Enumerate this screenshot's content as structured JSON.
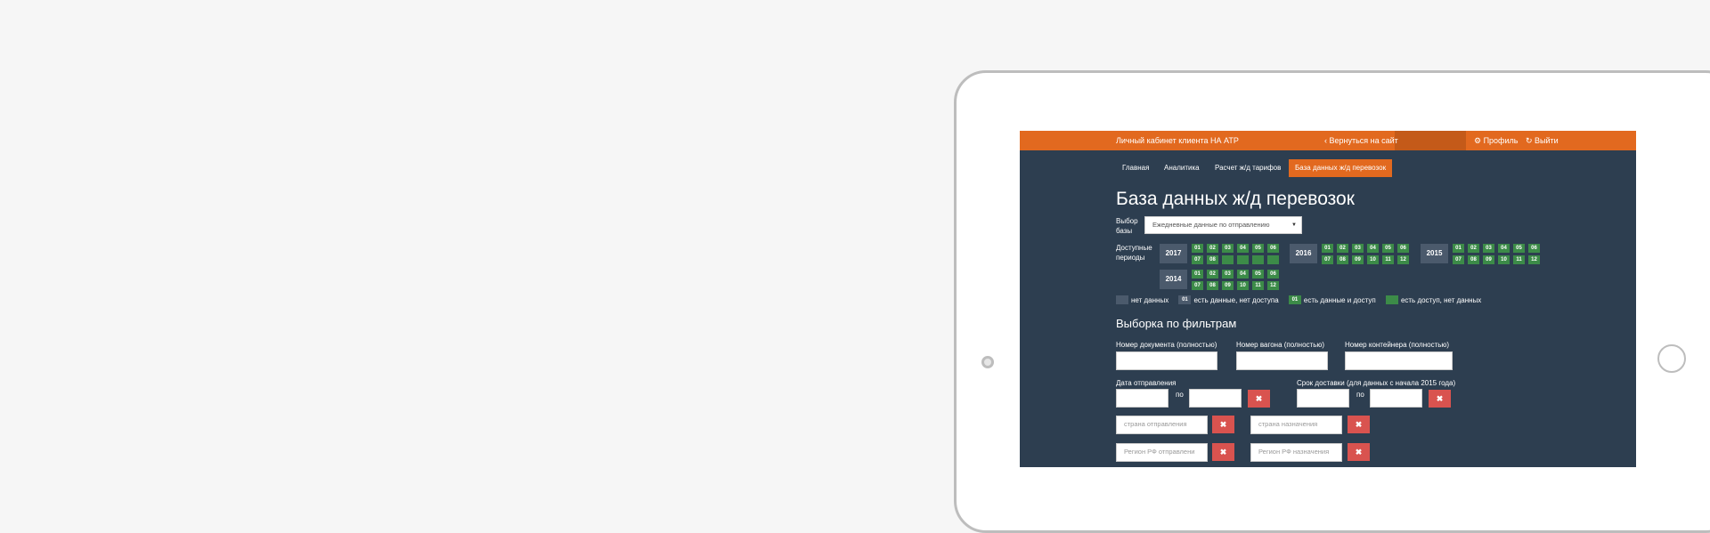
{
  "header": {
    "title": "Личный кабинет клиента НА АТР",
    "back_label": "Вернуться на сайт",
    "profile_label": "Профиль",
    "logout_label": "Выйти"
  },
  "tabs": [
    {
      "label": "Главная"
    },
    {
      "label": "Аналитика"
    },
    {
      "label": "Расчет ж/д тарифов"
    },
    {
      "label": "База данных ж/д перевозок",
      "active": true
    }
  ],
  "page_title": "База данных ж/д перевозок",
  "base_select": {
    "label": "Выбор базы",
    "value": "Ежедневные данные по отправлению"
  },
  "periods": {
    "label": "Доступные периоды",
    "years": [
      {
        "year": "2017",
        "months": [
          "01",
          "02",
          "03",
          "04",
          "05",
          "06",
          "07",
          "08",
          "",
          "",
          "",
          ""
        ]
      },
      {
        "year": "2016",
        "months": [
          "01",
          "02",
          "03",
          "04",
          "05",
          "06",
          "07",
          "08",
          "09",
          "10",
          "11",
          "12"
        ]
      },
      {
        "year": "2015",
        "months": [
          "01",
          "02",
          "03",
          "04",
          "05",
          "06",
          "07",
          "08",
          "09",
          "10",
          "11",
          "12"
        ]
      },
      {
        "year": "2014",
        "months": [
          "01",
          "02",
          "03",
          "04",
          "05",
          "06",
          "07",
          "08",
          "09",
          "10",
          "11",
          "12"
        ]
      }
    ]
  },
  "legend": [
    {
      "swatch": "",
      "color": "#4b5a6c",
      "text": "нет данных"
    },
    {
      "swatch": "01",
      "color": "#4b5a6c",
      "text": "есть данные, нет доступа"
    },
    {
      "swatch": "01",
      "color": "#3c8b48",
      "text": "есть данные и доступ"
    },
    {
      "swatch": "",
      "color": "#3c8b48",
      "text": "есть доступ, нет данных"
    }
  ],
  "filters": {
    "title": "Выборка по фильтрам",
    "doc_label": "Номер документа (полностью)",
    "wagon_label": "Номер вагона (полностью)",
    "container_label": "Номер контейнера (полностью)",
    "date_label": "Дата отправления",
    "delivery_label": "Срок доставки (для данных с начала 2015 года)",
    "to_label": "по",
    "country_from_placeholder": "страна отправления",
    "country_to_placeholder": "страна назначения",
    "region_from_placeholder": "Регион РФ отправлени",
    "region_to_placeholder": "Регион РФ назначения",
    "clear_symbol": "✖"
  },
  "colors": {
    "accent": "#e2691f",
    "panel": "#2d3e50",
    "green": "#3c8b48",
    "danger": "#d9534f"
  }
}
